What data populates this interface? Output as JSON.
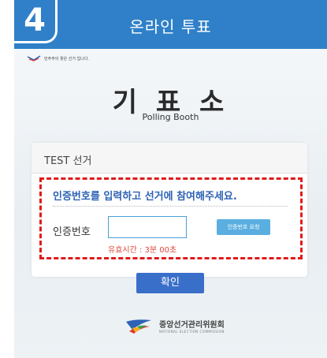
{
  "step_badge": "4",
  "header": {
    "title": "온라인 투표"
  },
  "tagline": "민주주의 꽃은 선거 입니다.",
  "booth": {
    "title": "기 표 소",
    "subtitle": "Polling Booth"
  },
  "election": {
    "name": "TEST 선거"
  },
  "auth": {
    "instruction": "인증번호를 입력하고 선거에 참여해주세요.",
    "label": "인증번호",
    "input_value": "",
    "input_placeholder": "",
    "request_button": "인증번호 요청",
    "validity": "유효시간 : 3분 00초"
  },
  "confirm_button": "확인",
  "footer": {
    "org_ko": "중앙선거관리위원회",
    "org_en": "NATIONAL ELECTION COMMISSION"
  },
  "colors": {
    "header": "#2f80c8",
    "highlight_border": "#e11a1a",
    "instruction_text": "#2d62b4",
    "confirm_button": "#3a6fc9",
    "request_button": "#5aaee0",
    "validity_text": "#e0453a"
  }
}
